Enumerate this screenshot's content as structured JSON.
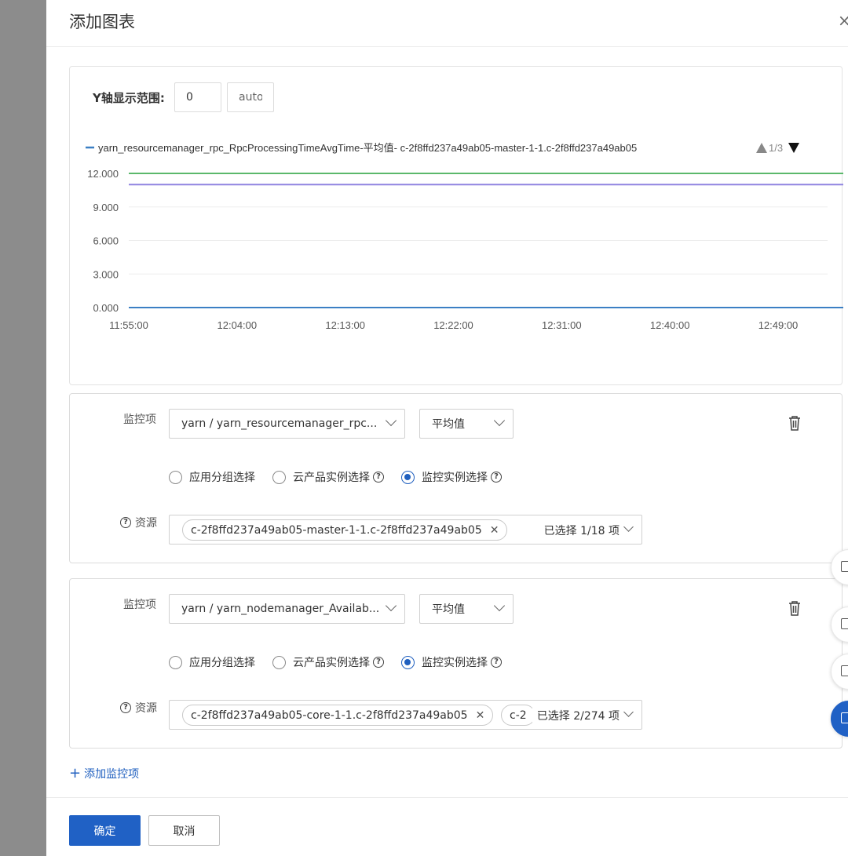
{
  "drawer": {
    "title": "添加图表",
    "close_glyph": "×"
  },
  "yrange": {
    "label": "Y轴显示范围:",
    "min": "0",
    "max": "auto"
  },
  "chart_data": {
    "type": "line",
    "legend": "yarn_resourcemanager_rpc_RpcProcessingTimeAvgTime-平均值- c-2f8ffd237a49ab05-master-1-1.c-2f8ffd237a49ab05",
    "legend_pager": "1/3",
    "legend_placement": "top",
    "x_ticks": [
      "11:55:00",
      "12:04:00",
      "12:13:00",
      "12:22:00",
      "12:31:00",
      "12:40:00",
      "12:49:00"
    ],
    "y_ticks": [
      "0.000",
      "3.000",
      "6.000",
      "9.000",
      "12.000"
    ],
    "ylim": [
      0,
      12
    ],
    "grid": true,
    "series": [
      {
        "color": "#5bb86b",
        "x": [
          "11:55:00",
          "12:56:00"
        ],
        "values": [
          12,
          12
        ]
      },
      {
        "color": "#8f84e0",
        "x": [
          "11:55:00",
          "12:58:00"
        ],
        "values": [
          11,
          11
        ]
      },
      {
        "color": "#3b7fc4",
        "x": [
          "11:55:00",
          "12:56:00"
        ],
        "values": [
          0,
          0
        ]
      }
    ]
  },
  "cards": [
    {
      "metric_label": "监控项",
      "metric_value": "yarn / yarn_resourcemanager_rpc...",
      "agg_value": "平均值",
      "radios": [
        "应用分组选择",
        "云产品实例选择",
        "监控实例选择"
      ],
      "resource_label": "资源",
      "tags": [
        "c-2f8ffd237a49ab05-master-1-1.c-2f8ffd237a49ab05"
      ],
      "count": "已选择 1/18 项"
    },
    {
      "metric_label": "监控项",
      "metric_value": "yarn / yarn_nodemanager_Availab...",
      "agg_value": "平均值",
      "radios": [
        "应用分组选择",
        "云产品实例选择",
        "监控实例选择"
      ],
      "resource_label": "资源",
      "tags": [
        "c-2f8ffd237a49ab05-core-1-1.c-2f8ffd237a49ab05",
        "c-2"
      ],
      "count": "已选择 2/274 项"
    }
  ],
  "add_metric": "添加监控项",
  "footer": {
    "ok": "确定",
    "cancel": "取消"
  },
  "colors": {
    "primary": "#2061c5",
    "backdrop": "#8c8c8c"
  }
}
